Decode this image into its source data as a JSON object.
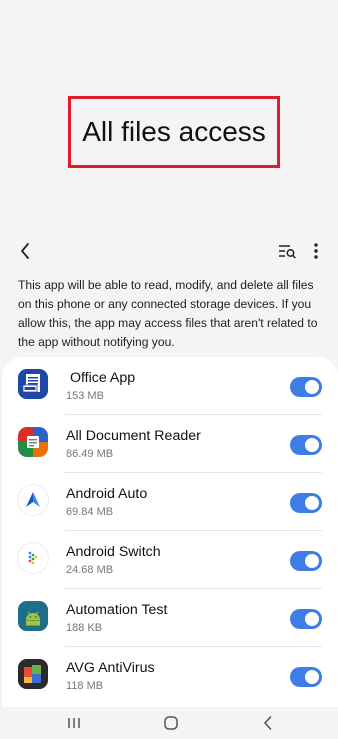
{
  "page": {
    "title": "All files access",
    "description": "This app will be able to read, modify, and delete all files on this phone or any connected storage devices. If you allow this, the app may access files that aren't related to the app without notifying you."
  },
  "toolbar": {
    "back_icon": "back-chevron-icon",
    "search_icon": "list-search-icon",
    "more_icon": "more-vertical-icon"
  },
  "apps": [
    {
      "name": " Office App",
      "size": "153 MB",
      "icon": "office-app-icon",
      "enabled": true
    },
    {
      "name": "All Document Reader",
      "size": "86.49 MB",
      "icon": "all-document-reader-icon",
      "enabled": true
    },
    {
      "name": "Android Auto",
      "size": "69.84 MB",
      "icon": "android-auto-icon",
      "enabled": true
    },
    {
      "name": "Android Switch",
      "size": "24.68 MB",
      "icon": "android-switch-icon",
      "enabled": true
    },
    {
      "name": "Automation Test",
      "size": "188 KB",
      "icon": "automation-test-icon",
      "enabled": true
    },
    {
      "name": "AVG AntiVirus",
      "size": "118 MB",
      "icon": "avg-antivirus-icon",
      "enabled": true
    }
  ],
  "navbar": {
    "recents_icon": "recents-icon",
    "home_icon": "home-icon",
    "back_icon": "nav-back-icon"
  },
  "colors": {
    "highlight_border": "#e01e2b",
    "toggle_on": "#3e7de6",
    "background": "#f4f4f6"
  }
}
